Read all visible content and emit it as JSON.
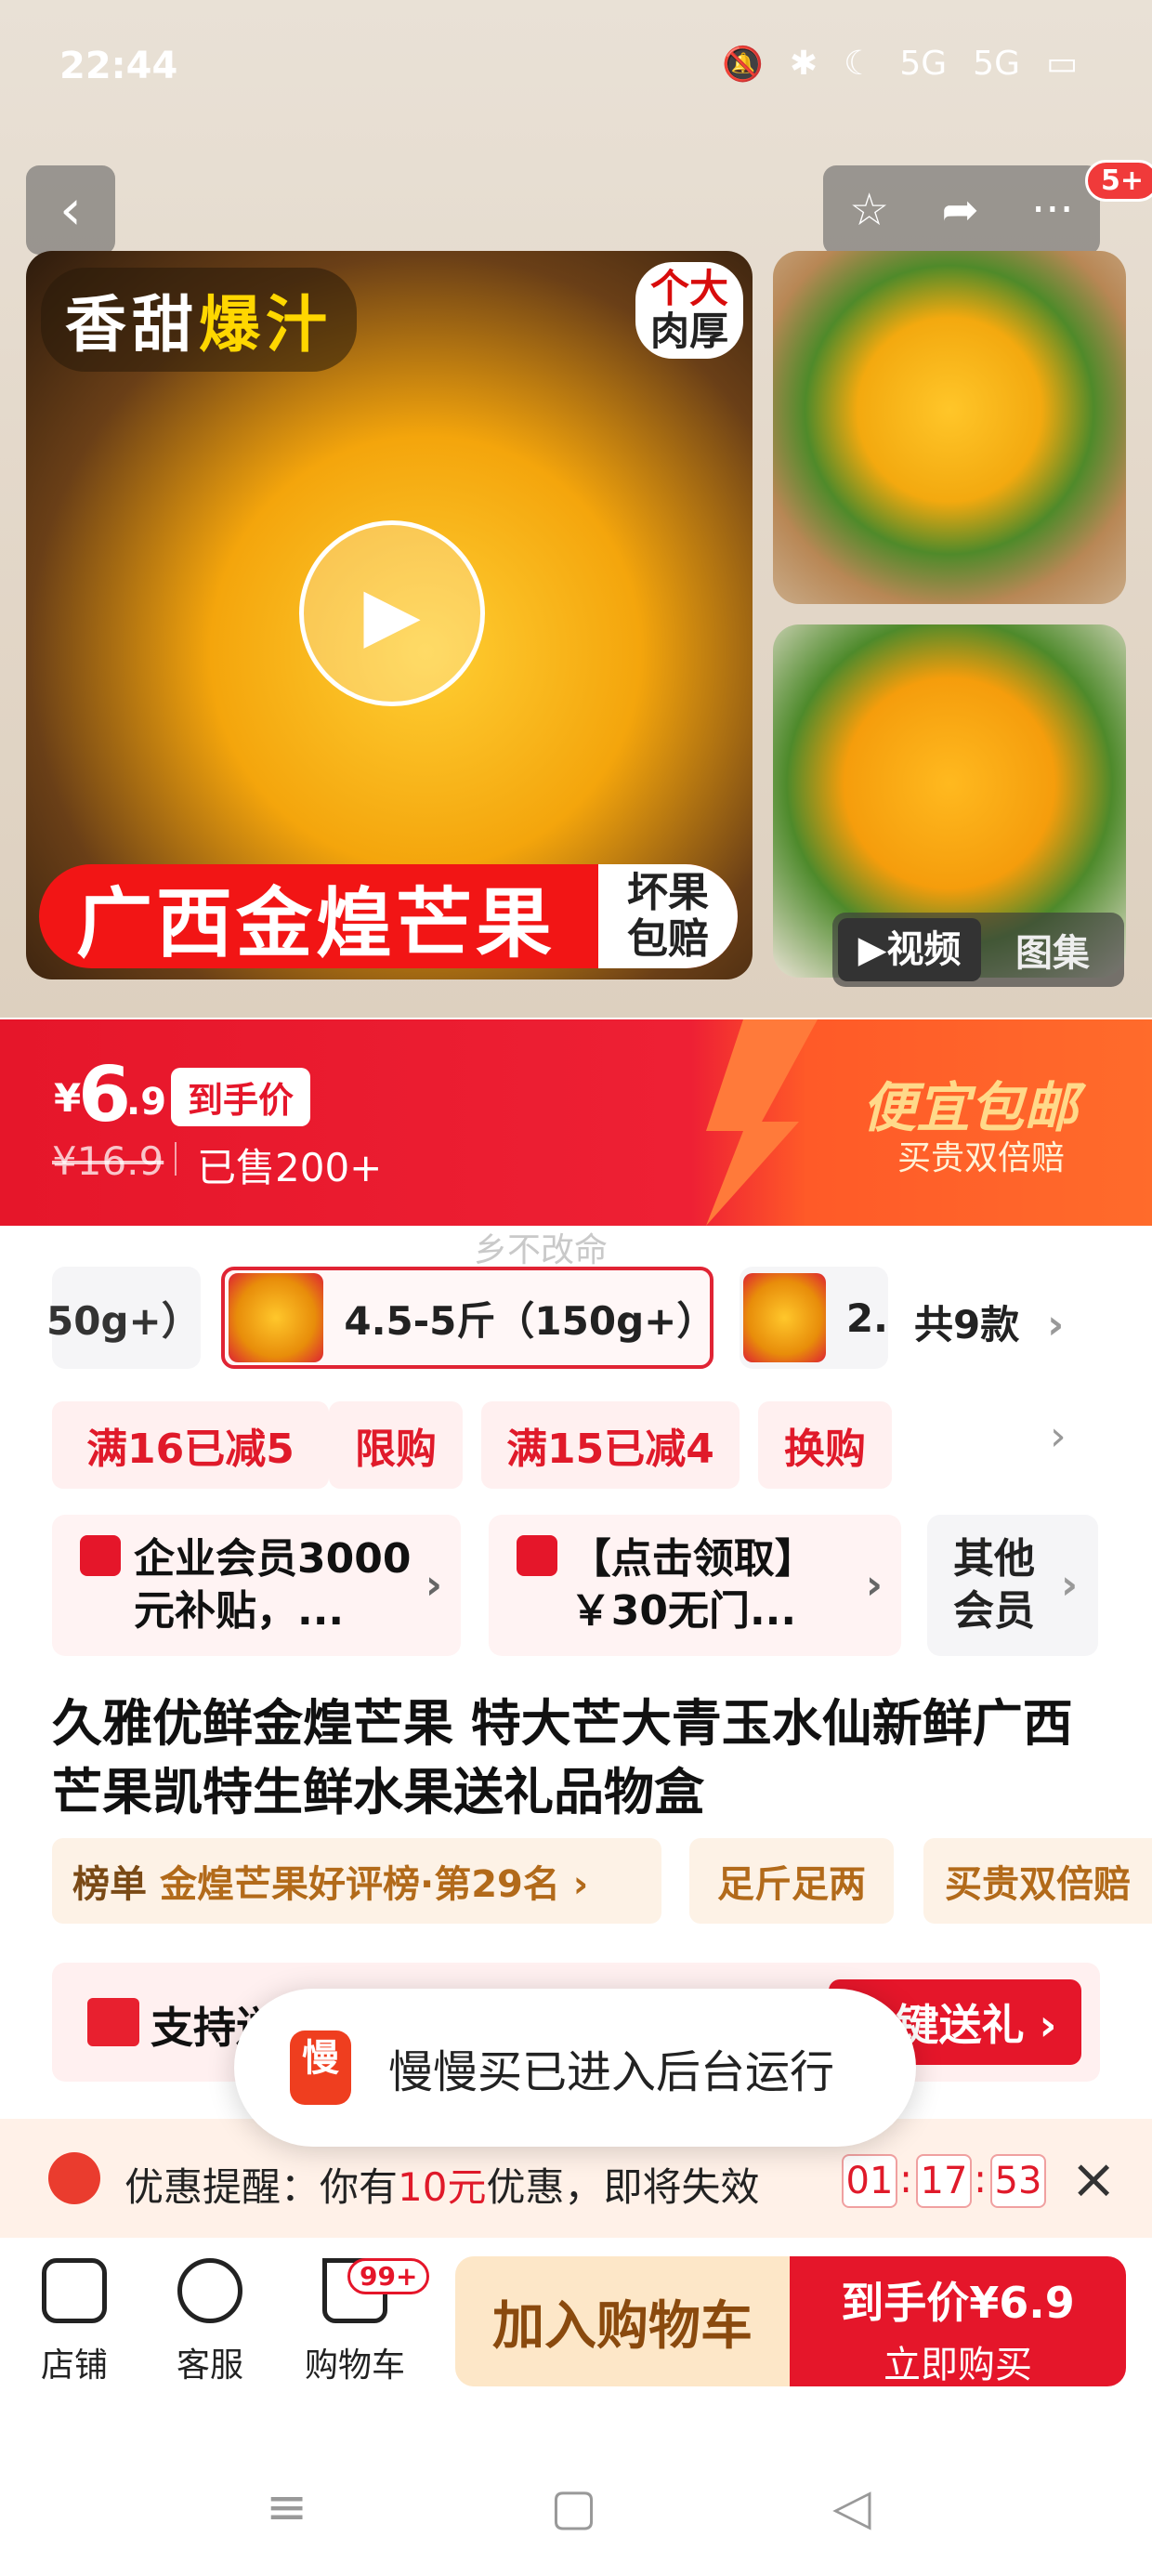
{
  "status": {
    "time": "22:44",
    "icons": [
      "🔕",
      "✱",
      "☾",
      "5G",
      "5G",
      "▭"
    ]
  },
  "top_actions": {
    "badge": "5+"
  },
  "gallery": {
    "tag_left_a": "香甜",
    "tag_left_b": "爆汁",
    "tag_right_1": "个大",
    "tag_right_2": "肉厚",
    "banner_title": "广西金煌芒果",
    "banner_badge_1": "坏果",
    "banner_badge_2": "包赔",
    "toggle_video": "▶视频",
    "toggle_gallery": "图集"
  },
  "price": {
    "symbol": "¥",
    "integer": "6",
    "decimal": ".9",
    "tag": "到手价",
    "original": "¥16.9",
    "sold": "已售200+",
    "promo_title": "便宜包邮",
    "promo_sub": "买贵双倍赔"
  },
  "watermark": "乡不改命",
  "sku": {
    "prev_label": "50g+）",
    "selected_label": "4.5-5斤（150g+）",
    "next_label": "2.",
    "count": "共9款"
  },
  "coupons": [
    "满16已减5",
    "限购",
    "满15已减4",
    "换购"
  ],
  "members": {
    "enterprise": "企业会员3000元补贴，...",
    "coupon": "【点击领取】￥30无门...",
    "other": "其他会员"
  },
  "product_title": "久雅优鲜金煌芒果 特大芒大青玉水仙新鲜广西芒果凯特生鲜水果送礼品物盒",
  "tags": {
    "rank_label": "榜单",
    "rank_text": "金煌芒果好评榜·第29名 ›",
    "tag2": "足斤足两",
    "tag3": "买贵双倍赔"
  },
  "gift": {
    "text": "支持送",
    "button": "一键送礼 ›"
  },
  "toast": {
    "icon": "慢",
    "text": "慢慢买已进入后台运行"
  },
  "reminder": {
    "prefix": "优惠提醒：你有",
    "amount": "10元",
    "suffix": "优惠，即将失效",
    "hh": "01",
    "mm": "17",
    "ss": "53"
  },
  "bottom": {
    "shop": "店铺",
    "service": "客服",
    "cart": "购物车",
    "cart_badge": "99+",
    "add_cart": "加入购物车",
    "buy_line1": "到手价¥6.9",
    "buy_line2": "立即购买"
  }
}
